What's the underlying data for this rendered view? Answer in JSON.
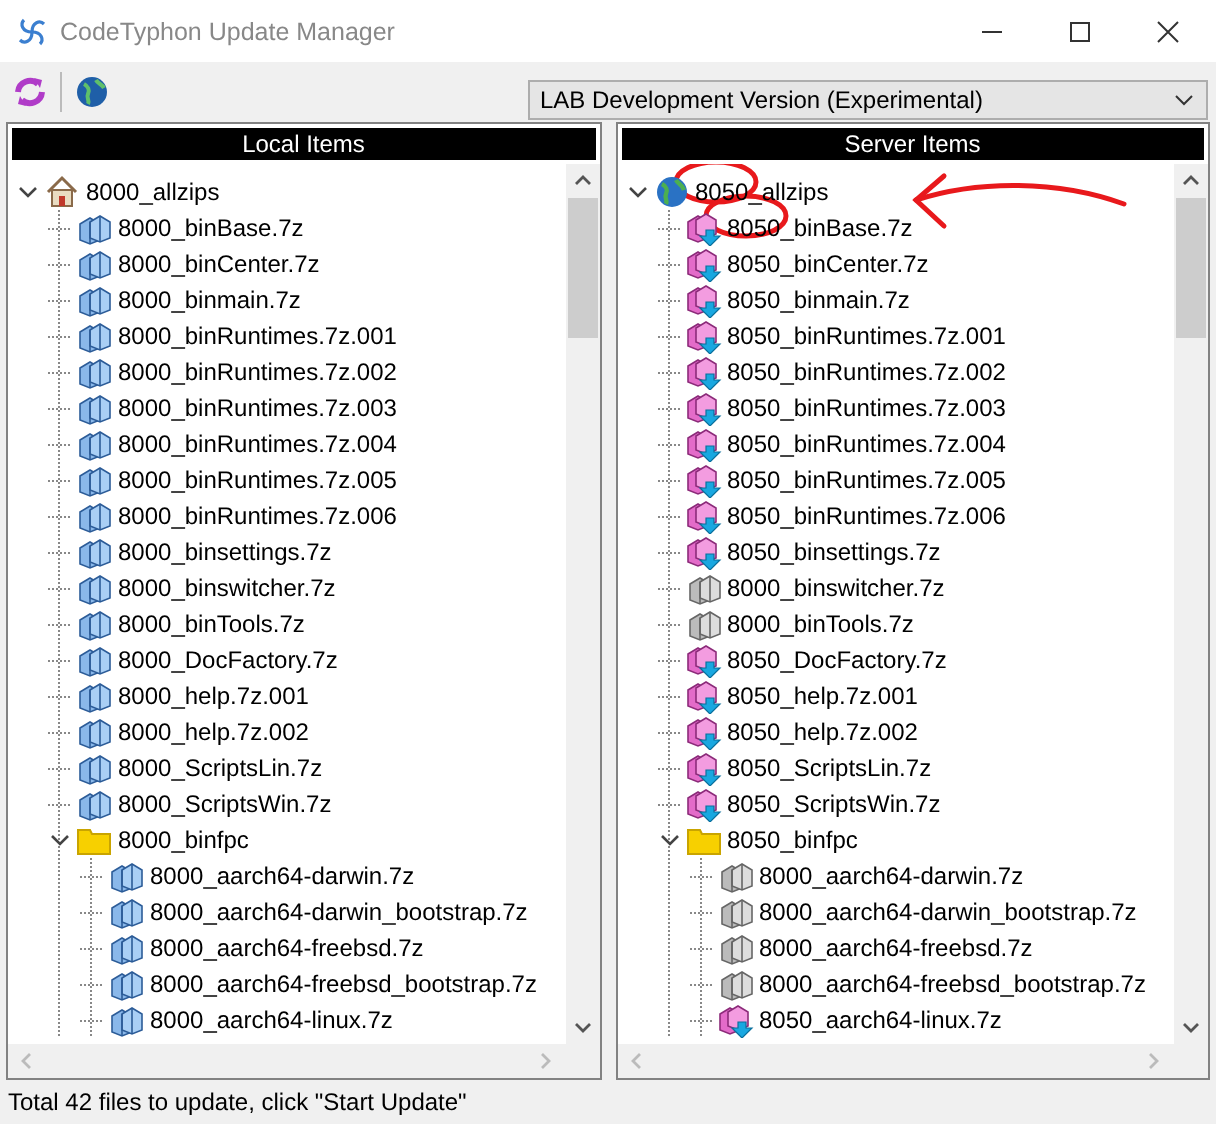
{
  "window": {
    "title": "CodeTyphon Update Manager"
  },
  "toolbar": {
    "version_select": {
      "value": "LAB Development Version (Experimental)"
    }
  },
  "panels": [
    {
      "title": "Local Items",
      "root": {
        "label": "8000_allzips",
        "kind": "home",
        "expanded": true,
        "children": [
          {
            "label": "8000_binBase.7z",
            "kind": "local"
          },
          {
            "label": "8000_binCenter.7z",
            "kind": "local"
          },
          {
            "label": "8000_binmain.7z",
            "kind": "local"
          },
          {
            "label": "8000_binRuntimes.7z.001",
            "kind": "local"
          },
          {
            "label": "8000_binRuntimes.7z.002",
            "kind": "local"
          },
          {
            "label": "8000_binRuntimes.7z.003",
            "kind": "local"
          },
          {
            "label": "8000_binRuntimes.7z.004",
            "kind": "local"
          },
          {
            "label": "8000_binRuntimes.7z.005",
            "kind": "local"
          },
          {
            "label": "8000_binRuntimes.7z.006",
            "kind": "local"
          },
          {
            "label": "8000_binsettings.7z",
            "kind": "local"
          },
          {
            "label": "8000_binswitcher.7z",
            "kind": "local"
          },
          {
            "label": "8000_binTools.7z",
            "kind": "local"
          },
          {
            "label": "8000_DocFactory.7z",
            "kind": "local"
          },
          {
            "label": "8000_help.7z.001",
            "kind": "local"
          },
          {
            "label": "8000_help.7z.002",
            "kind": "local"
          },
          {
            "label": "8000_ScriptsLin.7z",
            "kind": "local"
          },
          {
            "label": "8000_ScriptsWin.7z",
            "kind": "local"
          },
          {
            "label": "8000_binfpc",
            "kind": "folder",
            "expanded": true,
            "children": [
              {
                "label": "8000_aarch64-darwin.7z",
                "kind": "local"
              },
              {
                "label": "8000_aarch64-darwin_bootstrap.7z",
                "kind": "local"
              },
              {
                "label": "8000_aarch64-freebsd.7z",
                "kind": "local"
              },
              {
                "label": "8000_aarch64-freebsd_bootstrap.7z",
                "kind": "local"
              },
              {
                "label": "8000_aarch64-linux.7z",
                "kind": "local"
              }
            ]
          }
        ]
      }
    },
    {
      "title": "Server Items",
      "root": {
        "label": "8050_allzips",
        "kind": "globe",
        "expanded": true,
        "children": [
          {
            "label": "8050_binBase.7z",
            "kind": "update"
          },
          {
            "label": "8050_binCenter.7z",
            "kind": "update"
          },
          {
            "label": "8050_binmain.7z",
            "kind": "update"
          },
          {
            "label": "8050_binRuntimes.7z.001",
            "kind": "update"
          },
          {
            "label": "8050_binRuntimes.7z.002",
            "kind": "update"
          },
          {
            "label": "8050_binRuntimes.7z.003",
            "kind": "update"
          },
          {
            "label": "8050_binRuntimes.7z.004",
            "kind": "update"
          },
          {
            "label": "8050_binRuntimes.7z.005",
            "kind": "update"
          },
          {
            "label": "8050_binRuntimes.7z.006",
            "kind": "update"
          },
          {
            "label": "8050_binsettings.7z",
            "kind": "update"
          },
          {
            "label": "8000_binswitcher.7z",
            "kind": "same"
          },
          {
            "label": "8000_binTools.7z",
            "kind": "same"
          },
          {
            "label": "8050_DocFactory.7z",
            "kind": "update"
          },
          {
            "label": "8050_help.7z.001",
            "kind": "update"
          },
          {
            "label": "8050_help.7z.002",
            "kind": "update"
          },
          {
            "label": "8050_ScriptsLin.7z",
            "kind": "update"
          },
          {
            "label": "8050_ScriptsWin.7z",
            "kind": "update"
          },
          {
            "label": "8050_binfpc",
            "kind": "folder",
            "expanded": true,
            "children": [
              {
                "label": "8000_aarch64-darwin.7z",
                "kind": "same"
              },
              {
                "label": "8000_aarch64-darwin_bootstrap.7z",
                "kind": "same"
              },
              {
                "label": "8000_aarch64-freebsd.7z",
                "kind": "same"
              },
              {
                "label": "8000_aarch64-freebsd_bootstrap.7z",
                "kind": "same"
              },
              {
                "label": "8050_aarch64-linux.7z",
                "kind": "update"
              }
            ]
          }
        ]
      }
    }
  ],
  "status_bar": "Total 42 files to update, click \"Start Update\""
}
